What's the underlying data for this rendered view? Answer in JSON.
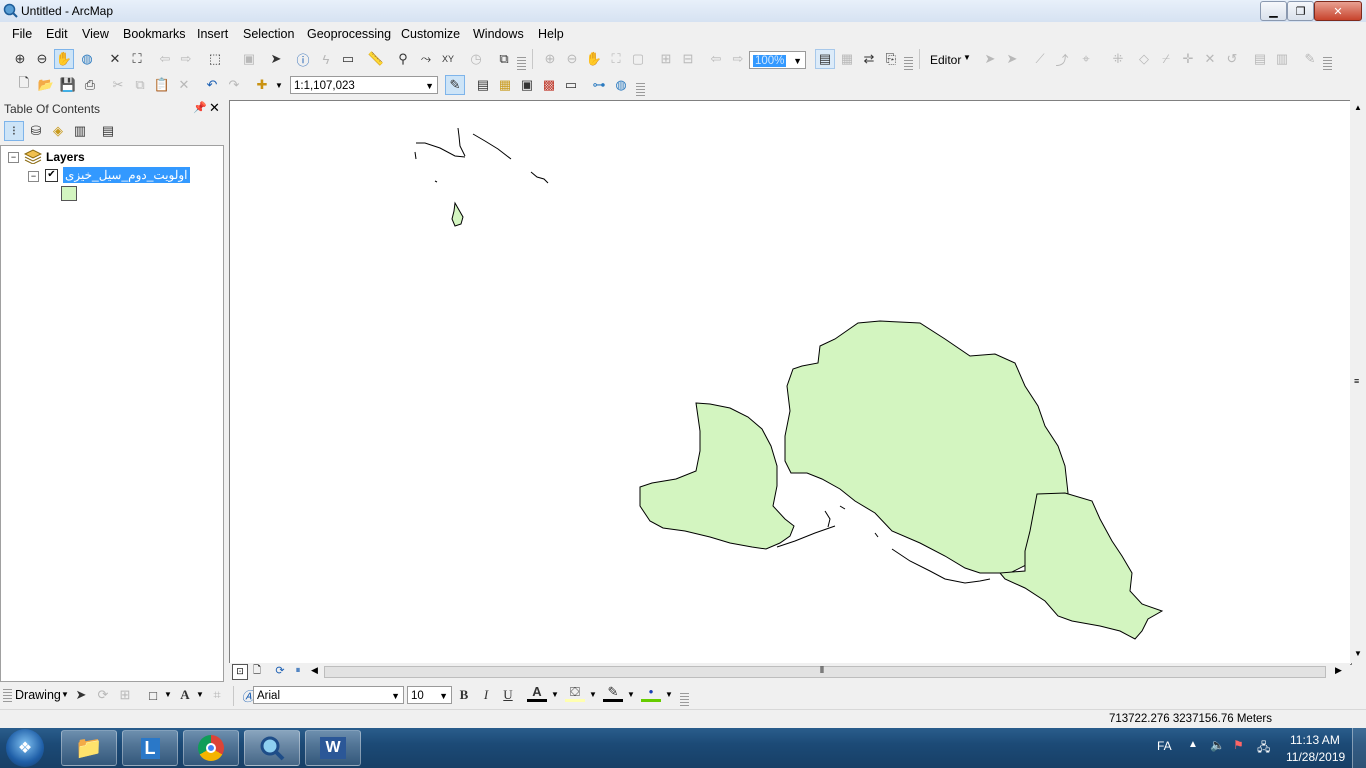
{
  "window": {
    "title": "Untitled - ArcMap"
  },
  "menu": [
    "File",
    "Edit",
    "View",
    "Bookmarks",
    "Insert",
    "Selection",
    "Geoprocessing",
    "Customize",
    "Windows",
    "Help"
  ],
  "toolbar": {
    "zoom_value": "100%",
    "scale_value": "1:1,107,023",
    "editor_label": "Editor"
  },
  "toc": {
    "title": "Table Of Contents",
    "root_label": "Layers",
    "layer_label": "اولویت_دوم_سیل_خیزی",
    "layer_checked": true,
    "symbol_color": "#d3f5c0"
  },
  "drawing": {
    "label": "Drawing",
    "font_name": "Arial",
    "font_size": "10",
    "bold": "B",
    "italic": "I",
    "underline": "U",
    "font_color_glyph": "A"
  },
  "status": {
    "coords": "713722.276  3237156.76 Meters"
  },
  "taskbar": {
    "lang": "FA",
    "time": "11:13 AM",
    "date": "11/28/2019"
  },
  "colors": {
    "polygon_fill": "#d3f5c0",
    "selection": "#3399ff"
  }
}
